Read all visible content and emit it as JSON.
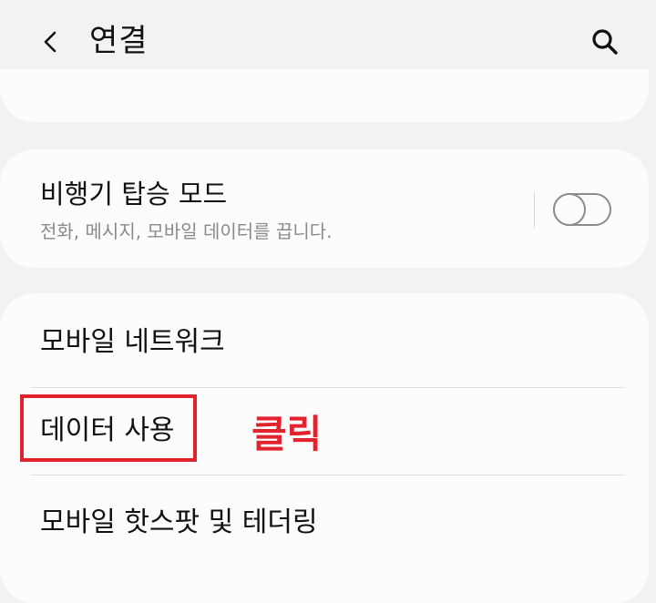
{
  "header": {
    "title": "연결",
    "back_icon": "chevron-left-icon",
    "search_icon": "search-icon"
  },
  "airplane_mode": {
    "title": "비행기 탑승 모드",
    "subtitle": "전화, 메시지, 모바일 데이터를 끕니다.",
    "enabled": false
  },
  "list": {
    "items": [
      {
        "label": "모바일 네트워크"
      },
      {
        "label": "데이터 사용"
      },
      {
        "label": "모바일 핫스팟 및 테더링"
      }
    ]
  },
  "annotation": {
    "label": "클릭",
    "color": "#e1232d"
  },
  "colors": {
    "background": "#f2f2f2",
    "card": "#fcfcfc",
    "subtitle_text": "#8a8a8a"
  }
}
